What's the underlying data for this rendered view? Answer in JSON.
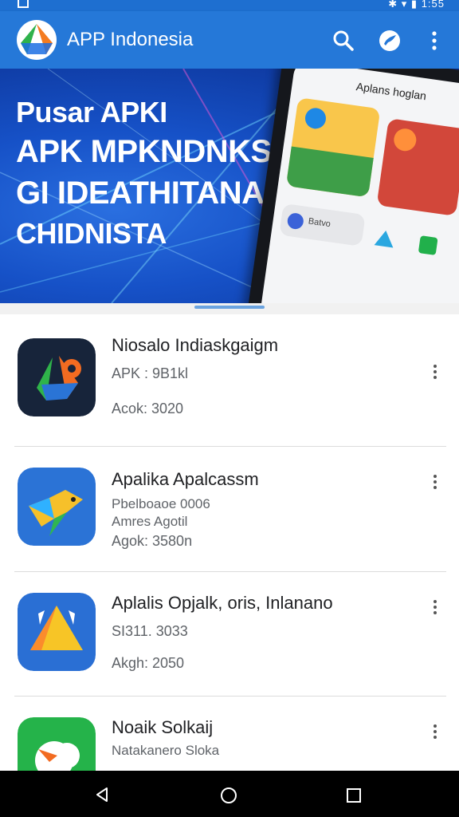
{
  "status_bar": {
    "right_text": "✱ ▾ ▮ 1:55"
  },
  "app_bar": {
    "title": "APP Indonesia",
    "actions": [
      "search-icon",
      "bird-icon",
      "more-vert-icon"
    ]
  },
  "banner": {
    "lines": [
      "Pusar APKI",
      "APK MPKNDNKSA",
      "GI IDEATHITANA",
      "CHIDNISTA"
    ],
    "phone_title": "Aplans hoglan",
    "phone_chip": "Batvo"
  },
  "apps": [
    {
      "title": "Niosalo Indiaskgaigm",
      "line1": "APK : 9B1kl",
      "line2": "Acok: 3020",
      "line3": ""
    },
    {
      "title": "Apalika Apalcassm",
      "line1": "Pbelboaoe 0006",
      "line2": "Amres Agotil",
      "line3": "Agok: 3580n"
    },
    {
      "title": "Aplalis Opjalk, oris, Inlanano",
      "line1": "SI311. 3033",
      "line2": "Akgh: 2050",
      "line3": ""
    },
    {
      "title": "Noaik Solkaij",
      "line1": "Natakanero Sloka",
      "line2": "",
      "line3": ""
    }
  ],
  "colors": {
    "appbar": "#2578d8",
    "status": "#1e6fd0",
    "banner": "#1651c7",
    "nav": "#000000"
  }
}
